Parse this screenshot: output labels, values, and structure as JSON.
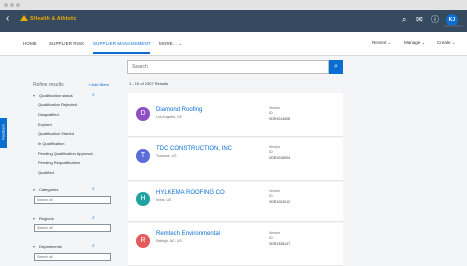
{
  "colors": {
    "shell": "#354a5f",
    "accent": "#0a6ed1",
    "brand": "#f0ab00",
    "avatar_purple": "#8e4fc3",
    "avatar_blue": "#5b6ed8",
    "avatar_teal": "#20a39e",
    "avatar_red": "#e35b5b"
  },
  "shell": {
    "back_icon": "chevron-left-icon",
    "brand_text": "SHealth & Athletic",
    "avatar_initials": "KJ",
    "status_alerts": "Status Alerts"
  },
  "nav": {
    "items": [
      "HOME",
      "SUPPLIER RISK",
      "SUPPLIER MANAGEMENT",
      "MORE..."
    ],
    "actions": [
      "Recent",
      "Manage",
      "Create"
    ]
  },
  "sidebar": {
    "title": "Refine results",
    "add_filters": "+ Add filters",
    "qualification": {
      "label": "Qualification status",
      "options": [
        "Qualification Rejected",
        "Disqualified",
        "Expired",
        "Qualification Started",
        "In Qualification",
        "Pending Qualification Approval",
        "Pending Requalification",
        "Qualified"
      ]
    },
    "categories": {
      "label": "Categories",
      "placeholder": "Search all"
    },
    "regions": {
      "label": "Regions",
      "placeholder": "Search all"
    },
    "departments": {
      "label": "Departments",
      "placeholder": "Search all"
    }
  },
  "feedback_label": "Feedback",
  "search": {
    "placeholder": "Search"
  },
  "results": {
    "count": "1 - 10 of 2307 Results",
    "vendor_label": "Vendor",
    "id_label": "ID:",
    "items": [
      {
        "initial": "D",
        "name": "Diamond Roofing",
        "location": "Los Angeles, US",
        "vendor_id": "VDR1014008"
      },
      {
        "initial": "T",
        "name": "TDC CONSTRUCTION, INC",
        "location": "Torrance, US",
        "vendor_id": "VDR1015004"
      },
      {
        "initial": "H",
        "name": "HYLKEMA ROOFING CO",
        "location": "Irvine, US",
        "vendor_id": "VDR1024012"
      },
      {
        "initial": "R",
        "name": "Remtech Environmental",
        "location": "Raleigh, NC, US",
        "vendor_id": "VDR1328147"
      }
    ]
  }
}
